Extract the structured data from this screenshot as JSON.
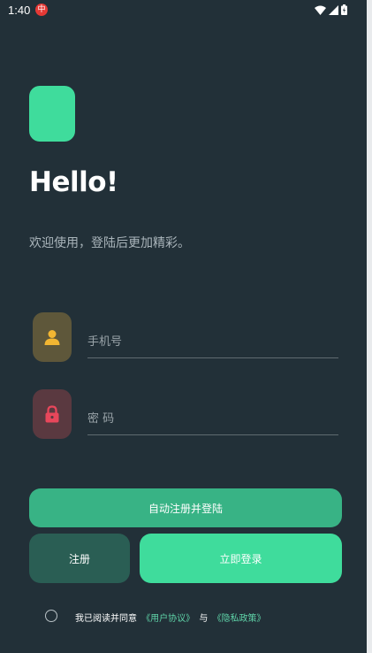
{
  "status_bar": {
    "time": "1:40",
    "notification_icon": "app-notification-icon",
    "icons": [
      "wifi-icon",
      "signal-icon",
      "battery-icon"
    ]
  },
  "login": {
    "greeting": "Hello!",
    "welcome": "欢迎使用，登陆后更加精彩。",
    "phone_placeholder": "手机号",
    "password_placeholder": "密 码",
    "auto_register_button": "自动注册并登陆",
    "register_button": "注册",
    "login_button": "立即登录",
    "agreement": {
      "prefix": "我已阅读并同意",
      "user_agreement": "《用户协议》",
      "conjunction": "与",
      "privacy_policy": "《隐私政策》"
    }
  },
  "colors": {
    "background": "#223038",
    "accent": "#3fdc9c",
    "auto_button": "#38b385",
    "register_button": "#2a5e54",
    "phone_icon_bg": "#5e573a",
    "phone_icon": "#f2b632",
    "password_icon_bg": "#5a3940",
    "password_icon": "#e8475b",
    "link": "#5fd3a8"
  }
}
